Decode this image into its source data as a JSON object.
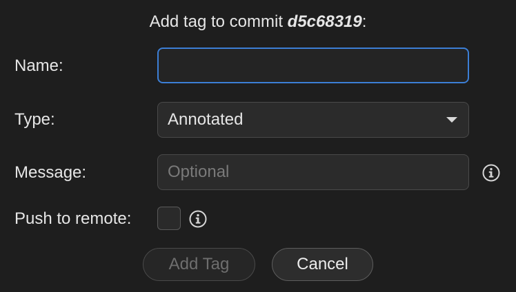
{
  "dialog": {
    "title_prefix": "Add tag to commit ",
    "commit_hash": "d5c68319",
    "title_suffix": ":"
  },
  "form": {
    "name": {
      "label": "Name:",
      "value": ""
    },
    "type": {
      "label": "Type:",
      "selected": "Annotated"
    },
    "message": {
      "label": "Message:",
      "placeholder": "Optional",
      "info_icon": "info-icon"
    },
    "push": {
      "label": "Push to remote:",
      "checked": false,
      "info_icon": "info-icon"
    }
  },
  "buttons": {
    "add_tag": "Add Tag",
    "cancel": "Cancel"
  },
  "colors": {
    "background": "#1e1e1e",
    "focus_border": "#3c7fd6"
  }
}
